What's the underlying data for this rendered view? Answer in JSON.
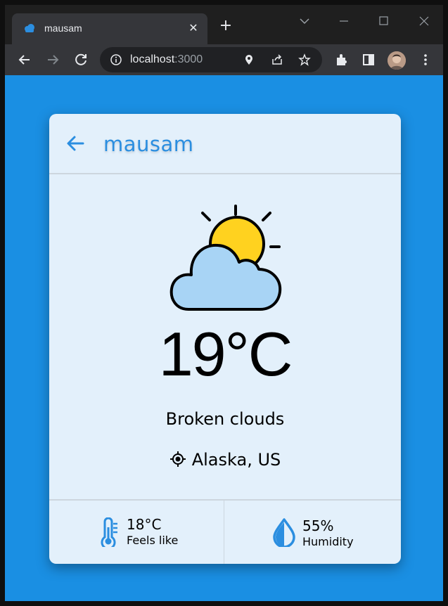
{
  "browser": {
    "tab_title": "mausam",
    "url_host": "localhost",
    "url_port": ":3000"
  },
  "app": {
    "title": "mausam",
    "temperature": "19°C",
    "description": "Broken clouds",
    "location": "Alaska, US",
    "feels_like_value": "18°C",
    "feels_like_label": "Feels like",
    "humidity_value": "55%",
    "humidity_label": "Humidity"
  },
  "colors": {
    "page_bg": "#1a8fe3",
    "card_bg": "#e3f0fb",
    "accent": "#2b8ee0",
    "sun": "#ffd21f",
    "cloud": "#a8d4f5"
  },
  "icons": {
    "weather": "sun-behind-cloud-icon",
    "back": "arrow-left-icon",
    "location": "crosshair-icon",
    "feels_like": "thermometer-icon",
    "humidity": "water-drop-icon"
  }
}
